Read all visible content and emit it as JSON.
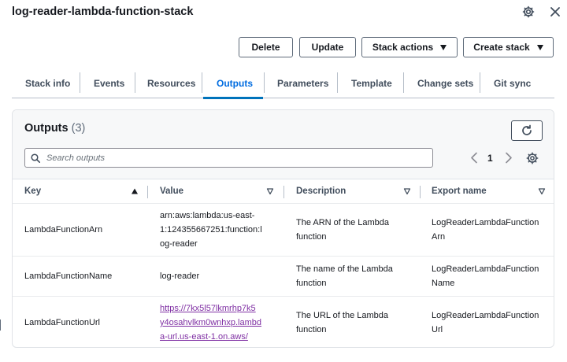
{
  "header": {
    "stack_title": "log-reader-lambda-function-stack",
    "icons": [
      "gear-icon",
      "close-icon"
    ]
  },
  "actions": {
    "delete_label": "Delete",
    "update_label": "Update",
    "stack_actions_label": "Stack actions",
    "create_stack_label": "Create stack"
  },
  "tabs": [
    {
      "label": "Stack info"
    },
    {
      "label": "Events"
    },
    {
      "label": "Resources"
    },
    {
      "label": "Outputs",
      "active": true
    },
    {
      "label": "Parameters"
    },
    {
      "label": "Template"
    },
    {
      "label": "Change sets"
    },
    {
      "label": "Git sync"
    }
  ],
  "outputs": {
    "title": "Outputs",
    "count": "(3)",
    "search_placeholder": "Search outputs",
    "page": "1",
    "columns": [
      "Key",
      "Value",
      "Description",
      "Export name"
    ],
    "rows": [
      {
        "key": "LambdaFunctionArn",
        "value_lines": [
          "arn:aws:lambda:us-east-",
          "1:124355667251:function:l",
          "og-reader"
        ],
        "description_lines": [
          "The ARN of the Lambda",
          "function"
        ],
        "export_lines": [
          "LogReaderLambdaFunction",
          "Arn"
        ]
      },
      {
        "key": "LambdaFunctionName",
        "value_lines": [
          "log-reader"
        ],
        "description_lines": [
          "The name of the Lambda",
          "function"
        ],
        "export_lines": [
          "LogReaderLambdaFunction",
          "Name"
        ]
      },
      {
        "key": "LambdaFunctionUrl",
        "value_lines": [
          "https://7kx5l57lkmrhp7k5",
          "y4osahvlkm0wnhxp.lambd",
          "a-url.us-east-1.on.aws/"
        ],
        "value_is_link": true,
        "description_lines": [
          "The URL of the Lambda",
          "function"
        ],
        "export_lines": [
          "LogReaderLambdaFunction",
          "Url"
        ]
      }
    ]
  },
  "colors": {
    "accent": "#006ce0",
    "link_visited": "#7f2fa3",
    "text": "#16191f"
  }
}
